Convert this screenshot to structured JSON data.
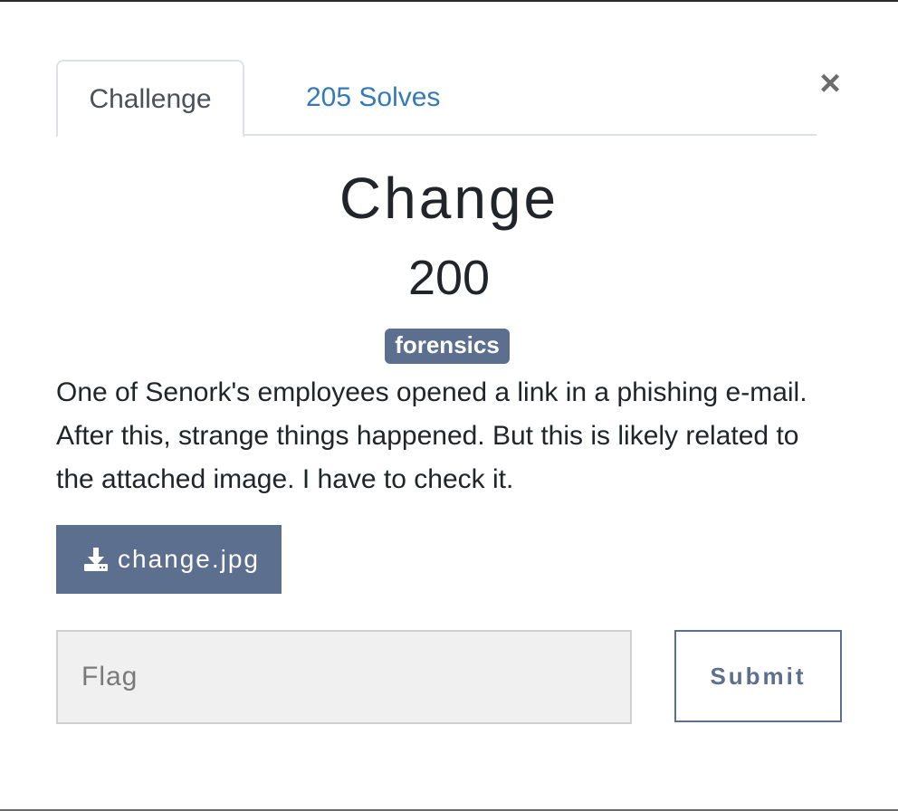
{
  "tabs": {
    "challenge_label": "Challenge",
    "solves_label": "205 Solves"
  },
  "close": {
    "symbol": "×",
    "icon": "close-icon"
  },
  "challenge": {
    "name": "Change",
    "points": "200",
    "tag": "forensics",
    "description": "One of Senork's employees opened a link in a phishing e-mail. After this, strange things happened. But this is likely related to the attached image. I have to check it.",
    "file": {
      "name": "change.jpg",
      "icon": "download-icon"
    }
  },
  "submission": {
    "placeholder": "Flag",
    "value": "",
    "submit_label": "Submit"
  },
  "colors": {
    "accent": "#5c6f8e",
    "link": "#337ab7"
  }
}
